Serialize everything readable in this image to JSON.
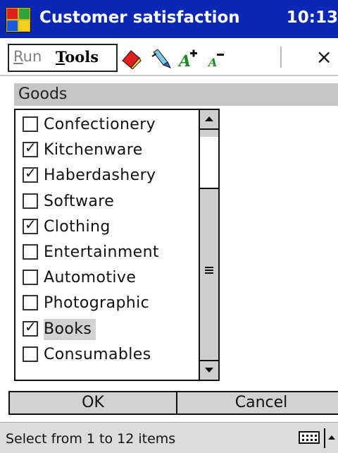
{
  "titlebar": {
    "title": "Customer satisfaction",
    "time": "10:13",
    "icons": {
      "start": "windows-flag-icon"
    }
  },
  "menubar": {
    "run_prefix": "R",
    "run_rest": "un",
    "tools_prefix": "T",
    "tools_rest": "ools",
    "close": "×",
    "icons": [
      "eraser-icon",
      "highlighter-icon",
      "font-larger-icon",
      "font-smaller-icon"
    ]
  },
  "section": {
    "title": "Goods"
  },
  "list": {
    "items": [
      {
        "label": "Confectionery",
        "checked": false
      },
      {
        "label": "Kitchenware",
        "checked": true
      },
      {
        "label": "Haberdashery",
        "checked": true
      },
      {
        "label": "Software",
        "checked": false
      },
      {
        "label": "Clothing",
        "checked": true
      },
      {
        "label": "Entertainment",
        "checked": false
      },
      {
        "label": "Automotive",
        "checked": false
      },
      {
        "label": "Photographic",
        "checked": false
      },
      {
        "label": "Books",
        "checked": true
      },
      {
        "label": "Consumables",
        "checked": false
      }
    ],
    "selected_index": 8
  },
  "buttons": {
    "ok": "OK",
    "cancel": "Cancel"
  },
  "status": {
    "text": "Select from 1 to 12 items",
    "check_glyph": "✓"
  },
  "colors": {
    "titlebar": "#0a28b4",
    "section": "#c6c6c6"
  }
}
